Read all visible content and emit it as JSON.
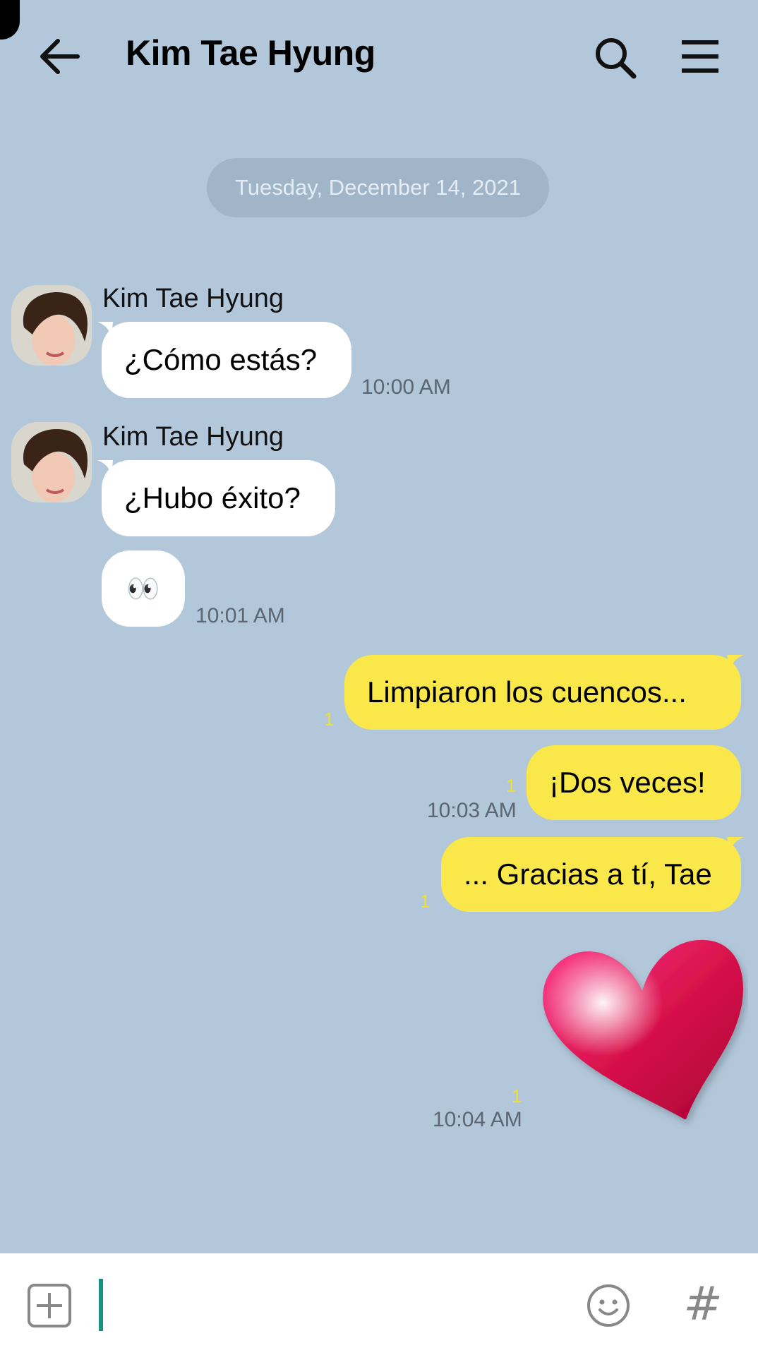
{
  "header": {
    "title": "Kim Tae Hyung",
    "icons": [
      "back-arrow-icon",
      "search-icon",
      "menu-icon"
    ]
  },
  "date_separator": "Tuesday, December 14, 2021",
  "messages": [
    {
      "sender": "Kim Tae Hyung",
      "text": "¿Cómo estás?",
      "time": "10:00 AM",
      "direction": "in"
    },
    {
      "sender": "Kim Tae Hyung",
      "text": "¿Hubo éxito?",
      "direction": "in"
    },
    {
      "text": "👀",
      "time": "10:01 AM",
      "direction": "in"
    },
    {
      "text": "Limpiaron los cuencos...",
      "unread": "1",
      "direction": "out"
    },
    {
      "text": "¡Dos veces!",
      "unread": "1",
      "time": "10:03 AM",
      "direction": "out"
    },
    {
      "text": "... Gracias a tí, Tae",
      "unread": "1",
      "direction": "out"
    },
    {
      "sticker": "heart-sticker",
      "unread": "1",
      "time": "10:04 AM",
      "direction": "out"
    }
  ],
  "input": {
    "icons": [
      "add-icon",
      "emoji-icon",
      "hashtag-icon"
    ],
    "hash_glyph": "#"
  },
  "colors": {
    "background": "#b2c7d9",
    "outgoing_bubble": "#fae84a",
    "incoming_bubble": "#ffffff",
    "unread_count": "#f0e030",
    "caret": "#1a9080"
  }
}
